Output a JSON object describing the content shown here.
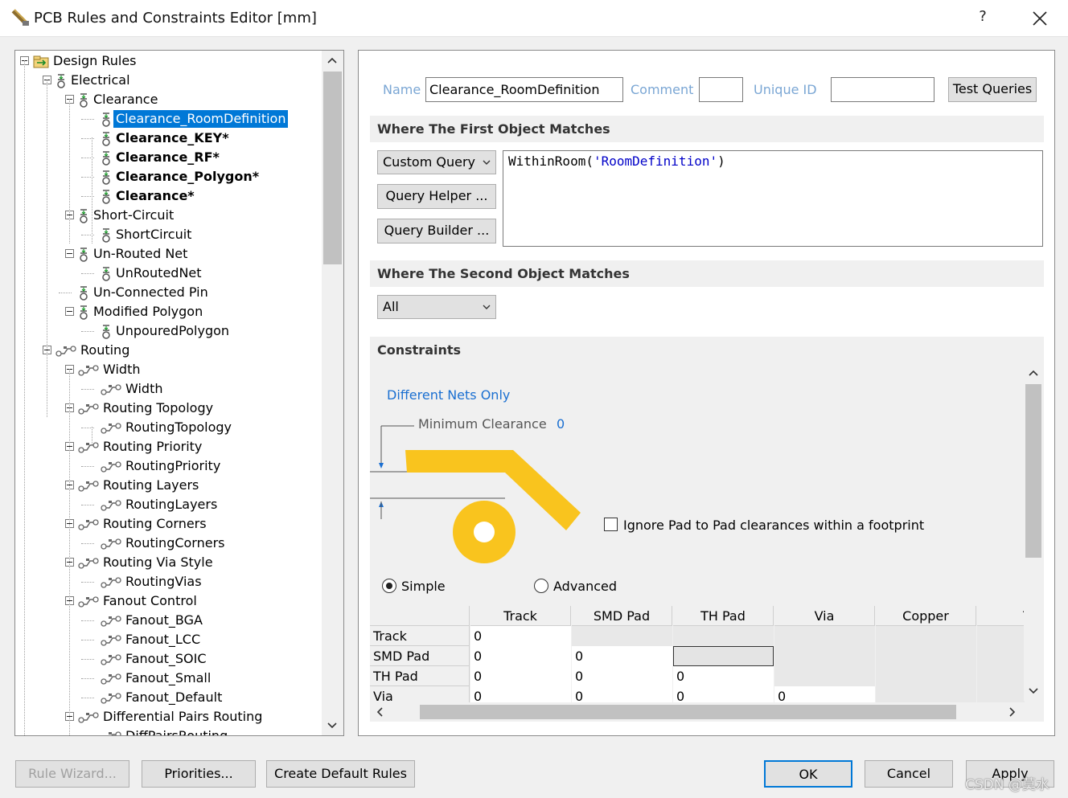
{
  "window": {
    "title": "PCB Rules and Constraints Editor [mm]",
    "help": "?"
  },
  "tree": {
    "items": [
      {
        "label": "Design Rules"
      },
      {
        "label": "Electrical"
      },
      {
        "label": "Clearance"
      },
      {
        "label": "Clearance_RoomDefinition"
      },
      {
        "label": "Clearance_KEY*"
      },
      {
        "label": "Clearance_RF*"
      },
      {
        "label": "Clearance_Polygon*"
      },
      {
        "label": "Clearance*"
      },
      {
        "label": "Short-Circuit"
      },
      {
        "label": "ShortCircuit"
      },
      {
        "label": "Un-Routed Net"
      },
      {
        "label": "UnRoutedNet"
      },
      {
        "label": "Un-Connected Pin"
      },
      {
        "label": "Modified Polygon"
      },
      {
        "label": "UnpouredPolygon"
      },
      {
        "label": "Routing"
      },
      {
        "label": "Width"
      },
      {
        "label": "Width"
      },
      {
        "label": "Routing Topology"
      },
      {
        "label": "RoutingTopology"
      },
      {
        "label": "Routing Priority"
      },
      {
        "label": "RoutingPriority"
      },
      {
        "label": "Routing Layers"
      },
      {
        "label": "RoutingLayers"
      },
      {
        "label": "Routing Corners"
      },
      {
        "label": "RoutingCorners"
      },
      {
        "label": "Routing Via Style"
      },
      {
        "label": "RoutingVias"
      },
      {
        "label": "Fanout Control"
      },
      {
        "label": "Fanout_BGA"
      },
      {
        "label": "Fanout_LCC"
      },
      {
        "label": "Fanout_SOIC"
      },
      {
        "label": "Fanout_Small"
      },
      {
        "label": "Fanout_Default"
      },
      {
        "label": "Differential Pairs Routing"
      },
      {
        "label": "DiffPairsRouting"
      }
    ]
  },
  "rule": {
    "name_label": "Name",
    "name_value": "Clearance_RoomDefinition",
    "comment_label": "Comment",
    "comment_value": "",
    "uid_label": "Unique ID",
    "uid_value": "",
    "test_queries": "Test Queries"
  },
  "first_object": {
    "header": "Where The First Object Matches",
    "combo": "Custom Query",
    "query_helper": "Query Helper ...",
    "query_builder": "Query Builder ...",
    "query_fn": "WithinRoom(",
    "query_arg": "'RoomDefinition'",
    "query_end": ")"
  },
  "second_object": {
    "header": "Where The Second Object Matches",
    "combo": "All"
  },
  "constraints": {
    "header": "Constraints",
    "different_nets": "Different Nets Only",
    "min_clearance_label": "Minimum Clearance",
    "min_clearance_value": "0",
    "ignore_pad": "Ignore Pad to Pad clearances within a footprint",
    "simple": "Simple",
    "advanced": "Advanced",
    "columns": [
      "Track",
      "SMD Pad",
      "TH Pad",
      "Via",
      "Copper",
      "T"
    ],
    "rows": [
      {
        "name": "Track",
        "values": [
          "0"
        ]
      },
      {
        "name": "SMD Pad",
        "values": [
          "0",
          "0"
        ]
      },
      {
        "name": "TH Pad",
        "values": [
          "0",
          "0",
          "0"
        ]
      },
      {
        "name": "Via",
        "values": [
          "0",
          "0",
          "0",
          "0"
        ]
      }
    ]
  },
  "footer": {
    "rule_wizard": "Rule Wizard...",
    "priorities": "Priorities...",
    "create_default": "Create Default Rules",
    "ok": "OK",
    "cancel": "Cancel",
    "apply": "Apply"
  },
  "watermark": "CSDN @莫水",
  "colors": {
    "selection": "#0078d7",
    "link_blue": "#1a6fd1",
    "field_label": "#7aa6d4",
    "track_yellow": "#f9c41e"
  }
}
